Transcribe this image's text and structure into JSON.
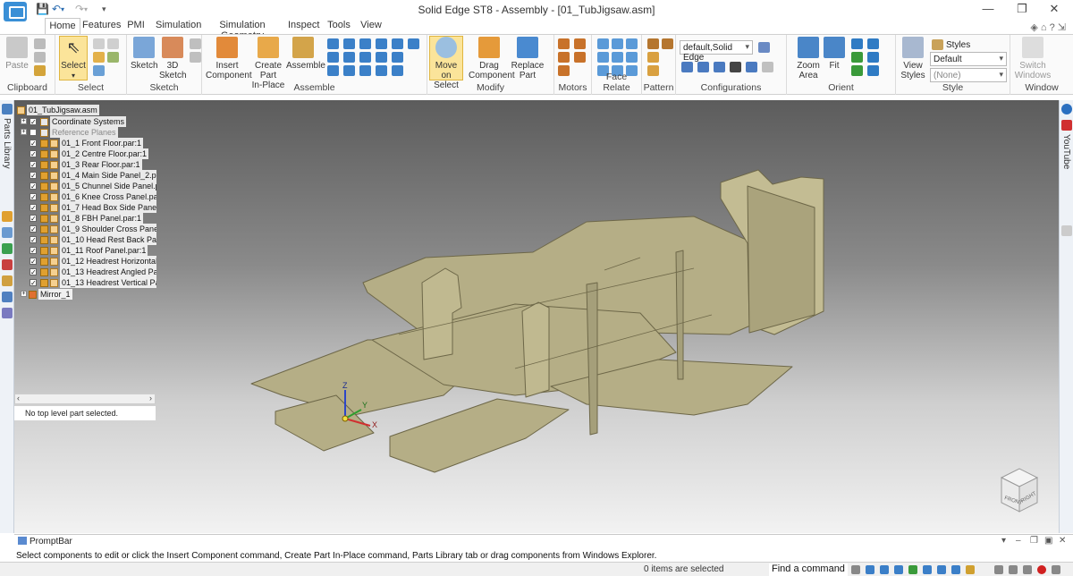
{
  "window": {
    "title": "Solid Edge ST8 - Assembly - [01_TubJigsaw.asm]",
    "minimize": "—",
    "maximize": "❐",
    "close": "✕"
  },
  "tabs": [
    "Home",
    "Features",
    "PMI",
    "Simulation",
    "Simulation Geometry",
    "Inspect",
    "Tools",
    "View"
  ],
  "ribbon": {
    "groups": {
      "clipboard": "Clipboard",
      "select": "Select",
      "sketch": "Sketch",
      "assemble": "Assemble",
      "modify": "Modify",
      "motors": "Motors",
      "face_relate": "Face Relate",
      "pattern": "Pattern",
      "configurations": "Configurations",
      "orient": "Orient",
      "style": "Style",
      "window": "Window"
    },
    "buttons": {
      "paste": "Paste",
      "select": "Select",
      "sketch": "Sketch",
      "sketch3d_1": "3D",
      "sketch3d_2": "Sketch",
      "insert_1": "Insert",
      "insert_2": "Component",
      "create_1": "Create Part",
      "create_2": "In-Place",
      "assemble": "Assemble",
      "move_1": "Move on",
      "move_2": "Select",
      "drag_1": "Drag",
      "drag_2": "Component",
      "replace_1": "Replace",
      "replace_2": "Part",
      "zoom_1": "Zoom",
      "zoom_2": "Area",
      "fit": "Fit",
      "view_1": "View",
      "view_2": "Styles",
      "switch_1": "Switch",
      "switch_2": "Windows",
      "styles": "Styles"
    },
    "config_value": "default,Solid Edge",
    "style_value": "Default",
    "style_value2": "(None)"
  },
  "side": {
    "parts_library": "Parts Library",
    "youtube": "YouTube"
  },
  "pathfinder": {
    "root": "01_TubJigsaw.asm",
    "items": [
      {
        "label": "Coordinate Systems"
      },
      {
        "label": "Reference Planes"
      },
      {
        "label": "01_1 Front Floor.par:1"
      },
      {
        "label": "01_2 Centre Floor.par:1"
      },
      {
        "label": "01_3 Rear Floor.par:1"
      },
      {
        "label": "01_4 Main Side Panel_2.par:1"
      },
      {
        "label": "01_5 Chunnel Side Panel.par:"
      },
      {
        "label": "01_6 Knee Cross Panel.par:1"
      },
      {
        "label": "01_7 Head Box Side Panel.pa"
      },
      {
        "label": "01_8 FBH Panel.par:1"
      },
      {
        "label": "01_9  Shoulder Cross Panel.p"
      },
      {
        "label": "01_10  Head Rest Back Panel"
      },
      {
        "label": "01_11  Roof Panel.par:1"
      },
      {
        "label": "01_12 Headrest Horizontal P"
      },
      {
        "label": "01_13 Headrest Angled Pane"
      },
      {
        "label": "01_13 Headrest Vertical Pane"
      },
      {
        "label": "Mirror_1"
      }
    ],
    "status": "No top level part selected."
  },
  "viewcube": {
    "front": "FRONT",
    "right": "RIGHT"
  },
  "triad": {
    "x": "X",
    "y": "Y",
    "z": "Z"
  },
  "promptbar": {
    "title": "PromptBar",
    "text": "Select components to edit or click the Insert Component command, Create Part In-Place command, Parts Library tab or drag components from Windows Explorer."
  },
  "statusbar": {
    "items_selected": "0 items are selected",
    "find_command": "Find a command"
  },
  "colors": {
    "model": "#b5ae86",
    "model_edge": "#6d6748",
    "selected_button": "#fbe49a"
  }
}
